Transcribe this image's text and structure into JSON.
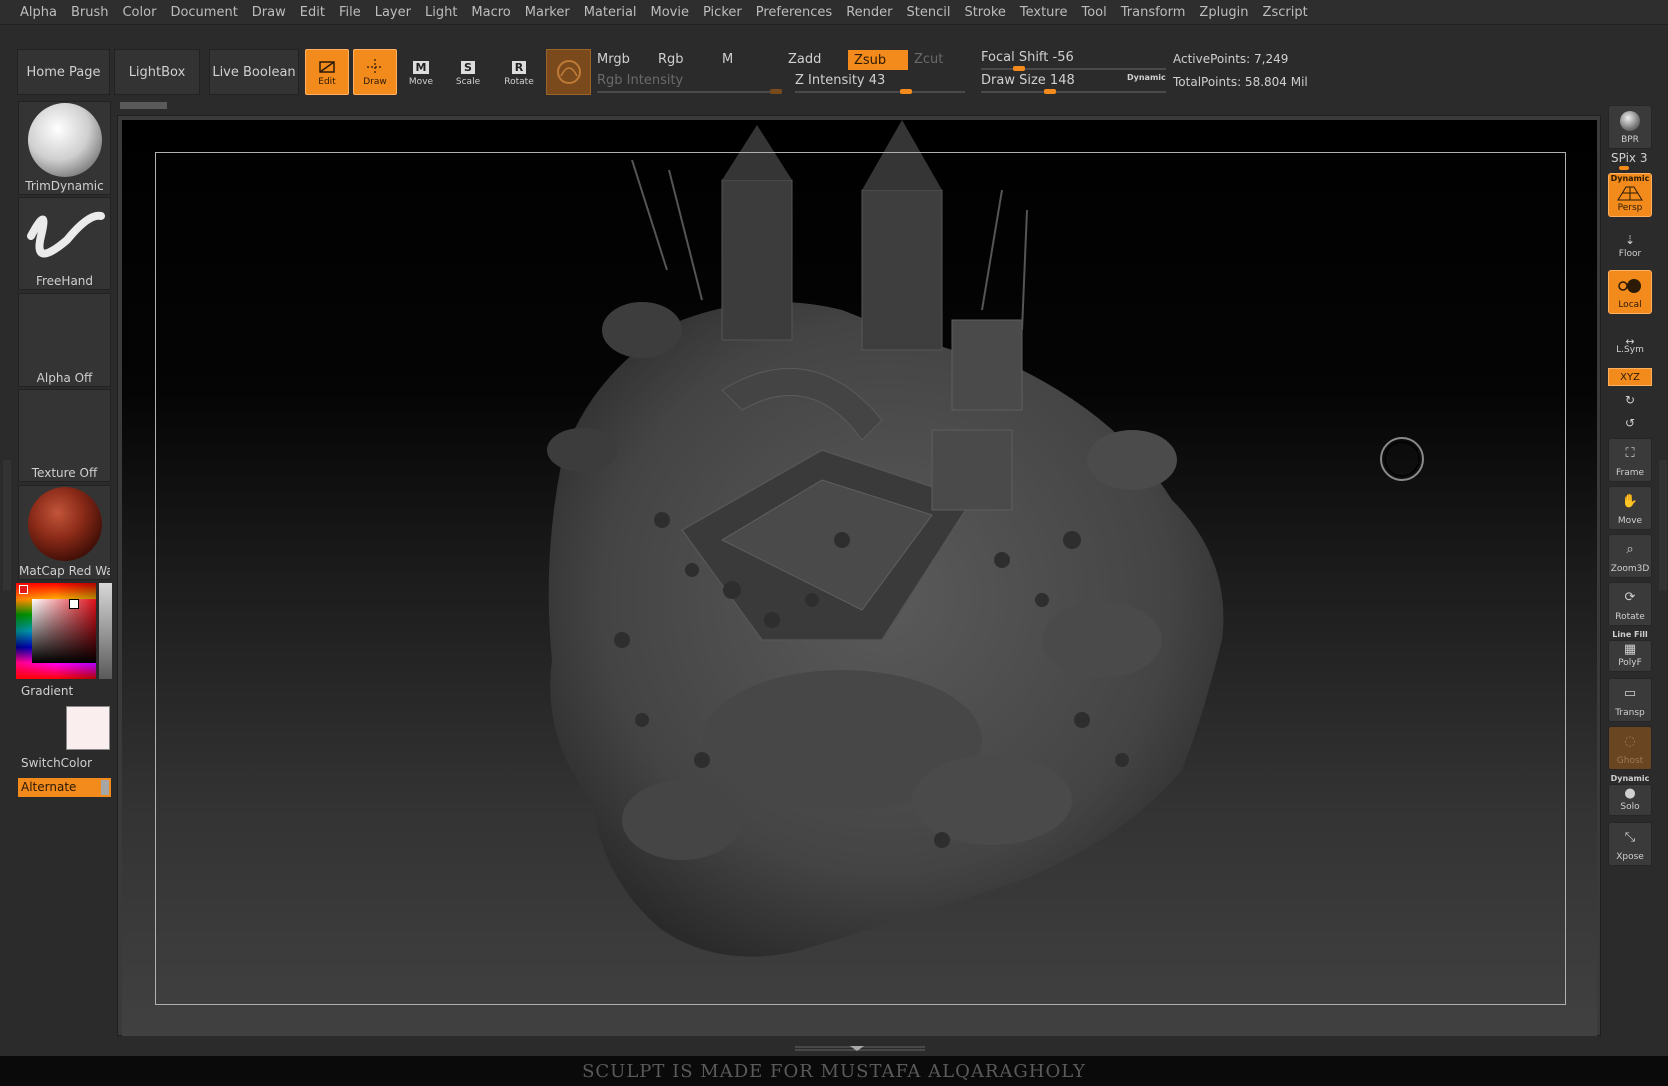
{
  "menu": [
    "Alpha",
    "Brush",
    "Color",
    "Document",
    "Draw",
    "Edit",
    "File",
    "Layer",
    "Light",
    "Macro",
    "Marker",
    "Material",
    "Movie",
    "Picker",
    "Preferences",
    "Render",
    "Stencil",
    "Stroke",
    "Texture",
    "Tool",
    "Transform",
    "Zplugin",
    "Zscript"
  ],
  "nav": {
    "home": "Home Page",
    "lightbox": "LightBox",
    "live_boolean": "Live Boolean"
  },
  "modes": {
    "edit": "Edit",
    "draw": "Draw",
    "move": "Move",
    "scale": "Scale",
    "rotate": "Rotate"
  },
  "shelf": {
    "mrgb": "Mrgb",
    "rgb": "Rgb",
    "m": "M",
    "rgb_intensity": "Rgb Intensity",
    "zadd": "Zadd",
    "zsub": "Zsub",
    "zcut": "Zcut",
    "z_intensity_label": "Z Intensity",
    "z_intensity": "43",
    "focal_shift_label": "Focal Shift",
    "focal_shift": "-56",
    "draw_size_label": "Draw Size",
    "draw_size": "148",
    "dynamic": "Dynamic",
    "active_points": "ActivePoints: 7,249",
    "total_points": "TotalPoints: 58.804 Mil"
  },
  "left_tray": {
    "brush": "TrimDynamic",
    "stroke": "FreeHand",
    "alpha": "Alpha Off",
    "texture": "Texture Off",
    "material": "MatCap Red Wax",
    "gradient": "Gradient",
    "switch_color": "SwitchColor",
    "alternate": "Alternate"
  },
  "right_tray": {
    "bpr": "BPR",
    "spix": "SPix 3",
    "persp_dynamic": "Dynamic",
    "persp": "Persp",
    "floor": "Floor",
    "local": "Local",
    "lsym": "L.Sym",
    "xyz": "XYZ",
    "frame": "Frame",
    "move": "Move",
    "zoom3d": "Zoom3D",
    "rotate": "Rotate",
    "line_fill": "Line Fill",
    "polyf": "PolyF",
    "transp": "Transp",
    "ghost": "Ghost",
    "solo_dynamic": "Dynamic",
    "solo": "Solo",
    "xpose": "Xpose"
  },
  "footer": "SCULPT  IS MADE FOR MUSTAFA ALQARAGHOLY",
  "colors": {
    "accent": "#f28a1c",
    "panel": "#2b2b2b",
    "main_color": "#fbeeee"
  },
  "progress": {
    "focal_shift_fraction": 0.44,
    "draw_size_fraction": 0.15,
    "z_intensity_fraction": 0.43
  }
}
